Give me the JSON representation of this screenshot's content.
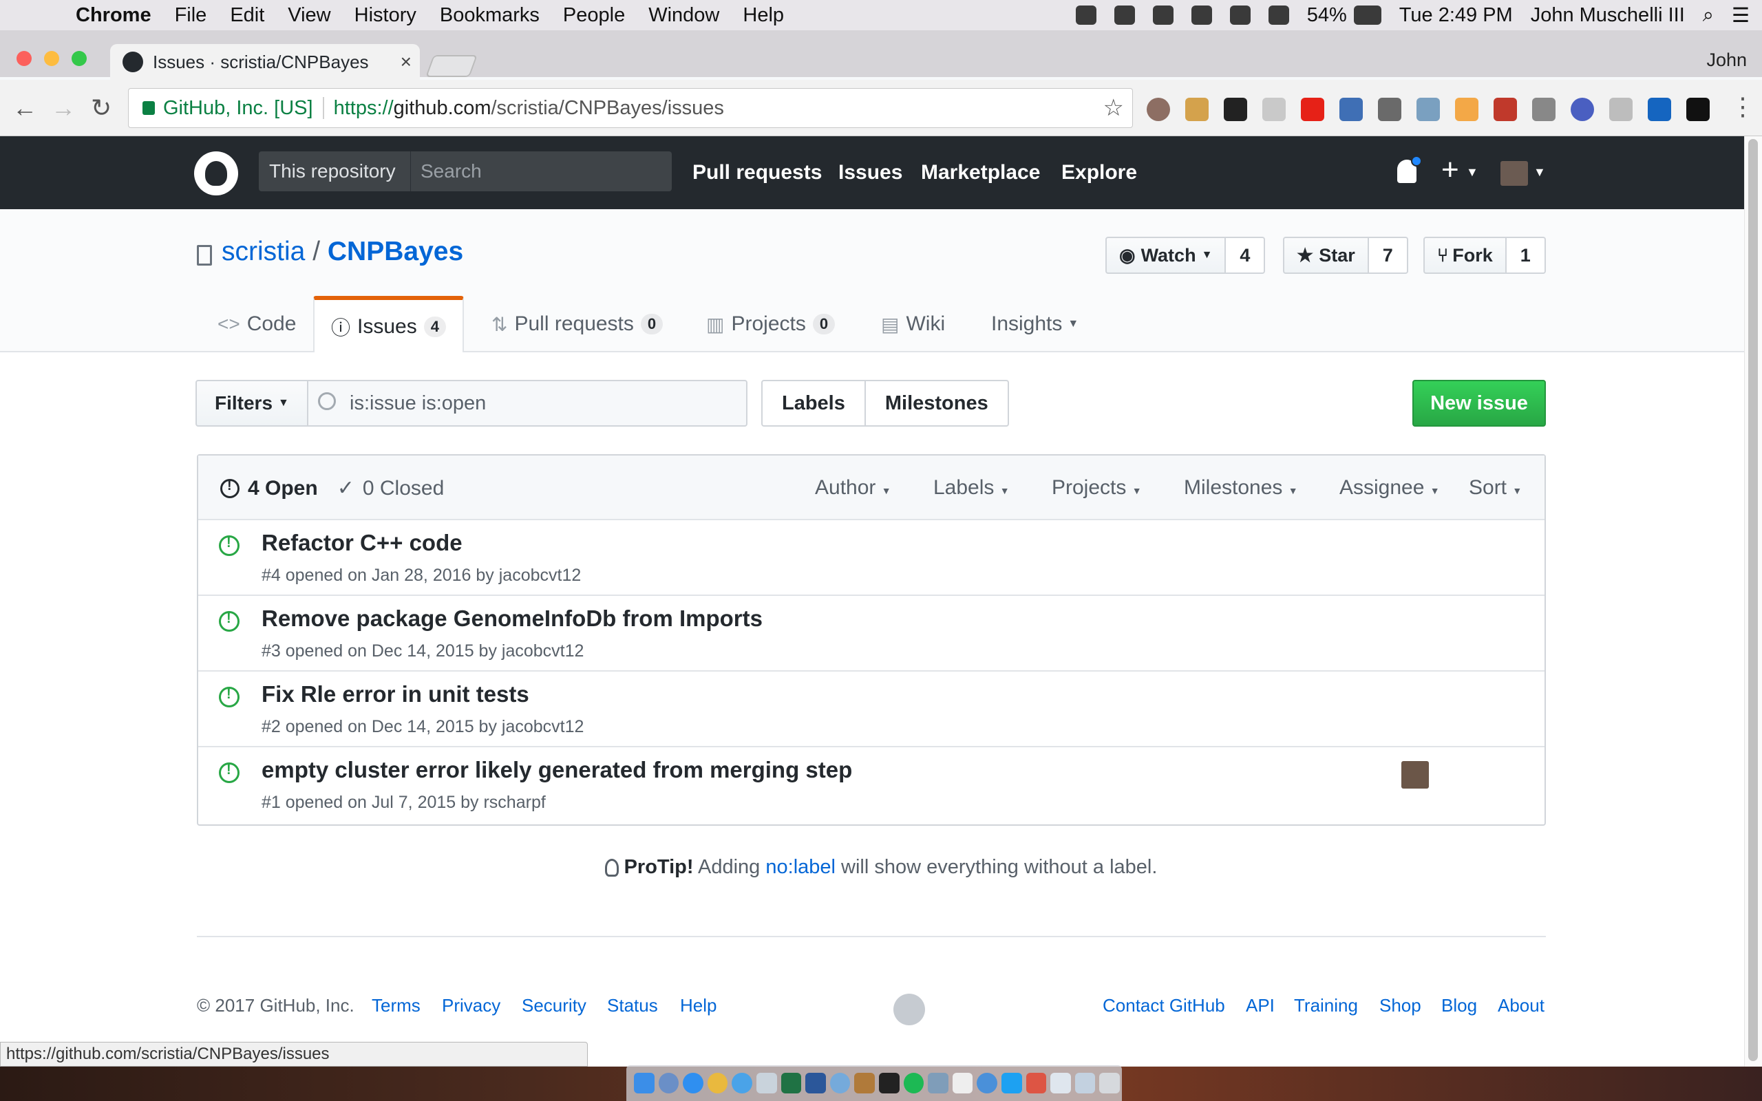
{
  "menubar": {
    "app": "Chrome",
    "items": [
      "File",
      "Edit",
      "View",
      "History",
      "Bookmarks",
      "People",
      "Window",
      "Help"
    ],
    "battery": "54%",
    "clock": "Tue 2:49 PM",
    "user": "John Muschelli III"
  },
  "browser": {
    "tab_title": "Issues · scristia/CNPBayes",
    "tab_close": "×",
    "profile_name": "John",
    "ev_cert": "GitHub, Inc. [US]",
    "url_proto": "https://",
    "url_host": "github.com",
    "url_path": "/scristia/CNPBayes/issues",
    "status_url": "https://github.com/scristia/CNPBayes/issues"
  },
  "gh_header": {
    "scope_label": "This repository",
    "search_placeholder": "Search",
    "nav": [
      "Pull requests",
      "Issues",
      "Marketplace",
      "Explore"
    ]
  },
  "repo": {
    "owner": "scristia",
    "separator": "/",
    "name": "CNPBayes",
    "watch_label": "Watch",
    "watch_count": "4",
    "star_label": "Star",
    "star_count": "7",
    "fork_label": "Fork",
    "fork_count": "1"
  },
  "reponav": {
    "code": "Code",
    "issues": "Issues",
    "issues_count": "4",
    "pulls": "Pull requests",
    "pulls_count": "0",
    "projects": "Projects",
    "projects_count": "0",
    "wiki": "Wiki",
    "insights": "Insights"
  },
  "toolbar": {
    "filters_label": "Filters",
    "filter_query": "is:issue is:open",
    "labels_label": "Labels",
    "milestones_label": "Milestones",
    "new_issue_label": "New issue"
  },
  "issues_header": {
    "open_label": "4 Open",
    "closed_label": "0 Closed",
    "filters": [
      "Author",
      "Labels",
      "Projects",
      "Milestones",
      "Assignee",
      "Sort"
    ]
  },
  "issues": [
    {
      "title": "Refactor C++ code",
      "meta": "#4 opened on Jan 28, 2016 by jacobcvt12"
    },
    {
      "title": "Remove package GenomeInfoDb from Imports",
      "meta": "#3 opened on Dec 14, 2015 by jacobcvt12"
    },
    {
      "title": "Fix Rle error in unit tests",
      "meta": "#2 opened on Dec 14, 2015 by jacobcvt12"
    },
    {
      "title": "empty cluster error likely generated from merging step",
      "meta": "#1 opened on Jul 7, 2015 by rscharpf"
    }
  ],
  "protip": {
    "lead": "ProTip!",
    "before": "Adding",
    "link": "no:label",
    "after": "will show everything without a label."
  },
  "footer": {
    "copyright": "© 2017 GitHub, Inc.",
    "left_links": [
      "Terms",
      "Privacy",
      "Security",
      "Status",
      "Help"
    ],
    "right_links": [
      "Contact GitHub",
      "API",
      "Training",
      "Shop",
      "Blog",
      "About"
    ]
  },
  "colors": {
    "github_dark": "#24292e",
    "link_blue": "#0366d6",
    "open_green": "#28a745",
    "selected_tab_orange": "#e36209"
  }
}
